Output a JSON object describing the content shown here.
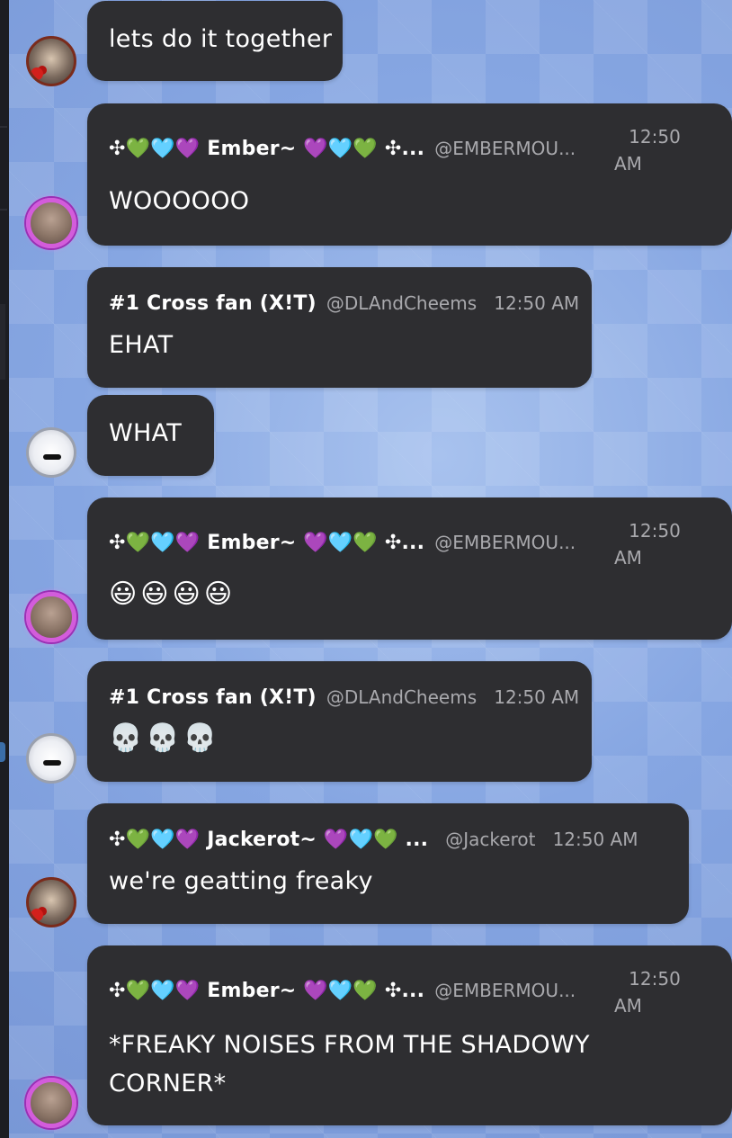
{
  "messages": [
    {
      "id": "m1",
      "avatar": "jackerot-avatar",
      "text": "lets do it together"
    },
    {
      "id": "m2",
      "avatar": "ember-avatar",
      "name": "✣💚🩵💜 Ember~ 💜🩵💚 ✣...",
      "handle": "@EMBERMOU...",
      "time_line1": "12:50",
      "time_line2": "AM",
      "text": "WOOOOOO"
    },
    {
      "id": "m3",
      "name": "#1 Cross fan (X!T)",
      "handle": "@DLAndCheems",
      "time": "12:50 AM",
      "text": "EHAT"
    },
    {
      "id": "m4",
      "avatar": "cross-fan-avatar",
      "text": "WHAT"
    },
    {
      "id": "m5",
      "avatar": "ember-avatar",
      "name": "✣💚🩵💜 Ember~ 💜🩵💚 ✣...",
      "handle": "@EMBERMOU...",
      "time_line1": "12:50",
      "time_line2": "AM",
      "text": "😃😃😃😃"
    },
    {
      "id": "m6",
      "avatar": "cross-fan-avatar",
      "name": "#1 Cross fan (X!T)",
      "handle": "@DLAndCheems",
      "time": "12:50 AM",
      "text": "💀💀💀"
    },
    {
      "id": "m7",
      "avatar": "jackerot-avatar",
      "name": "✣💚🩵💜 Jackerot~ 💜🩵💚 ...",
      "handle": "@Jackerot",
      "time": "12:50 AM",
      "text": "we're geatting freaky"
    },
    {
      "id": "m8",
      "avatar": "ember-avatar",
      "name": "✣💚🩵💜 Ember~ 💜🩵💚 ✣...",
      "handle": "@EMBERMOU...",
      "time_line1": "12:50",
      "time_line2": "AM",
      "text_line1": "*FREAKY NOISES FROM THE SHADOWY",
      "text_line2": "CORNER*"
    }
  ],
  "colors": {
    "bubble": "#2e2e31",
    "name": "#ffffff",
    "meta": "#a9a9ad",
    "background": "#7f9fdc",
    "ember_ring": "#d35cdb"
  }
}
